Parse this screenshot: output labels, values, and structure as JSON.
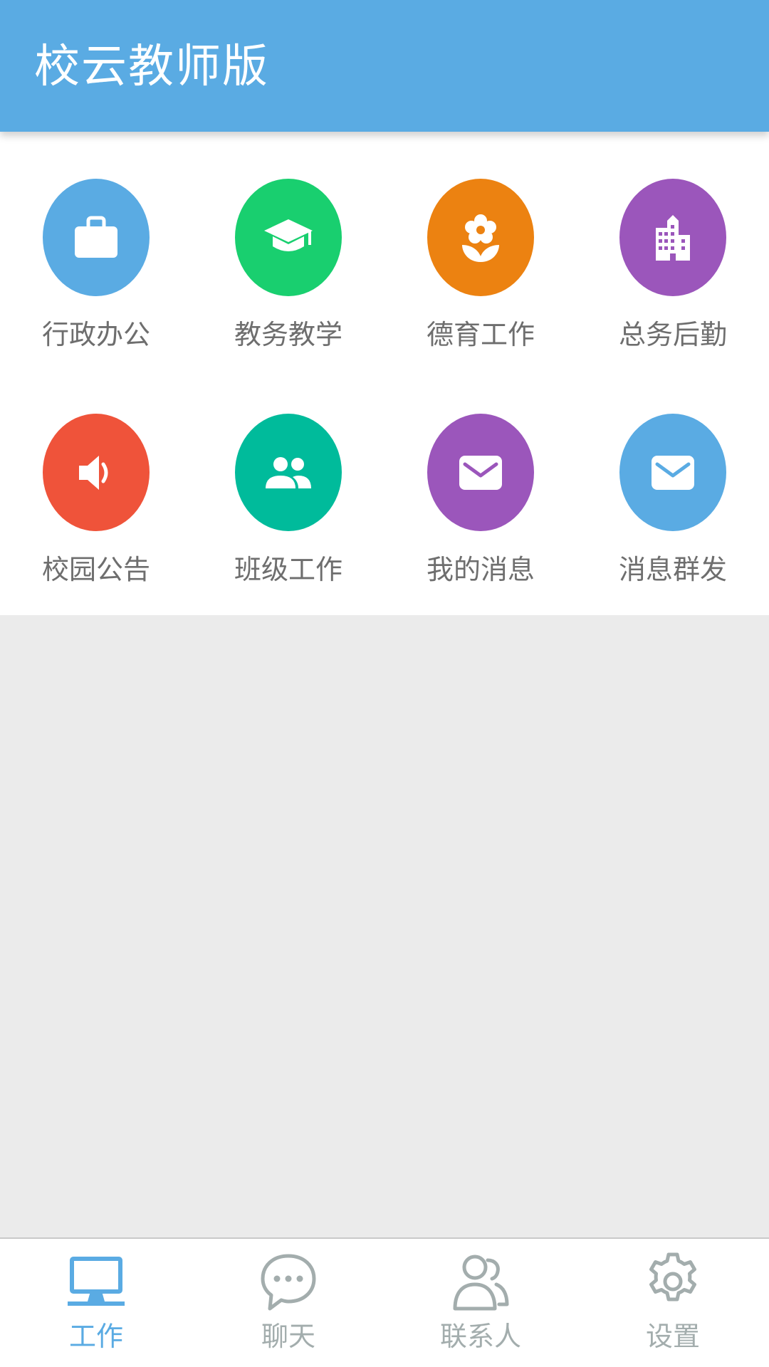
{
  "header": {
    "title": "校云教师版"
  },
  "colors": {
    "primary": "#5aabe3",
    "inactive": "#a3adad",
    "label": "#6e6e6e"
  },
  "grid": {
    "items": [
      {
        "label": "行政办公",
        "icon": "briefcase-icon",
        "color": "#5aabe3"
      },
      {
        "label": "教务教学",
        "icon": "graduation-cap-icon",
        "color": "#19cf6f"
      },
      {
        "label": "德育工作",
        "icon": "flower-icon",
        "color": "#ec8211"
      },
      {
        "label": "总务后勤",
        "icon": "building-icon",
        "color": "#9b56bb"
      },
      {
        "label": "校园公告",
        "icon": "speaker-icon",
        "color": "#ef533a"
      },
      {
        "label": "班级工作",
        "icon": "group-icon",
        "color": "#00bb9b"
      },
      {
        "label": "我的消息",
        "icon": "envelope-icon",
        "color": "#9b56bb"
      },
      {
        "label": "消息群发",
        "icon": "envelope-icon",
        "color": "#5aabe3"
      }
    ]
  },
  "bottom_nav": {
    "items": [
      {
        "label": "工作",
        "icon": "monitor-icon",
        "active": true
      },
      {
        "label": "聊天",
        "icon": "chat-bubble-icon",
        "active": false
      },
      {
        "label": "联系人",
        "icon": "contacts-icon",
        "active": false
      },
      {
        "label": "设置",
        "icon": "gear-icon",
        "active": false
      }
    ]
  }
}
